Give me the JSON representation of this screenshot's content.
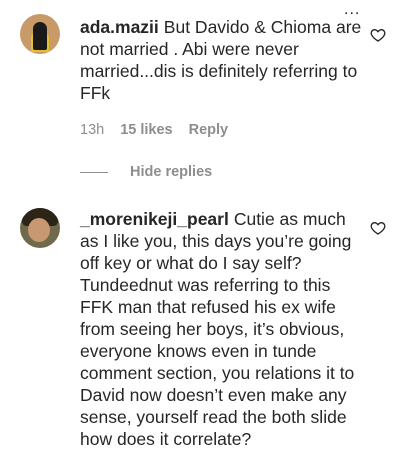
{
  "comments": [
    {
      "username": "ada.mazii",
      "text": "But Davido & Chioma are not married . Abi were never married...dis is definitely referring to FFk",
      "time": "13h",
      "likes": "15 likes",
      "reply_label": "Reply",
      "hide_replies_label": "Hide replies"
    },
    {
      "username": "_morenikeji_pearl",
      "text": "Cutie as much as I like you, this days you’re going off key or what do I say self? Tundeednut was referring to this FFK man that refused his ex wife from seeing her boys, it’s obvious, everyone knows even in tunde comment section, you relations it to David now doesn’t even make any sense, yourself read the both slide how does it correlate?"
    }
  ],
  "overlay": {
    "more_label": "..."
  },
  "icons": {
    "like": "heart-outline-icon",
    "more": "more-dots-icon"
  }
}
